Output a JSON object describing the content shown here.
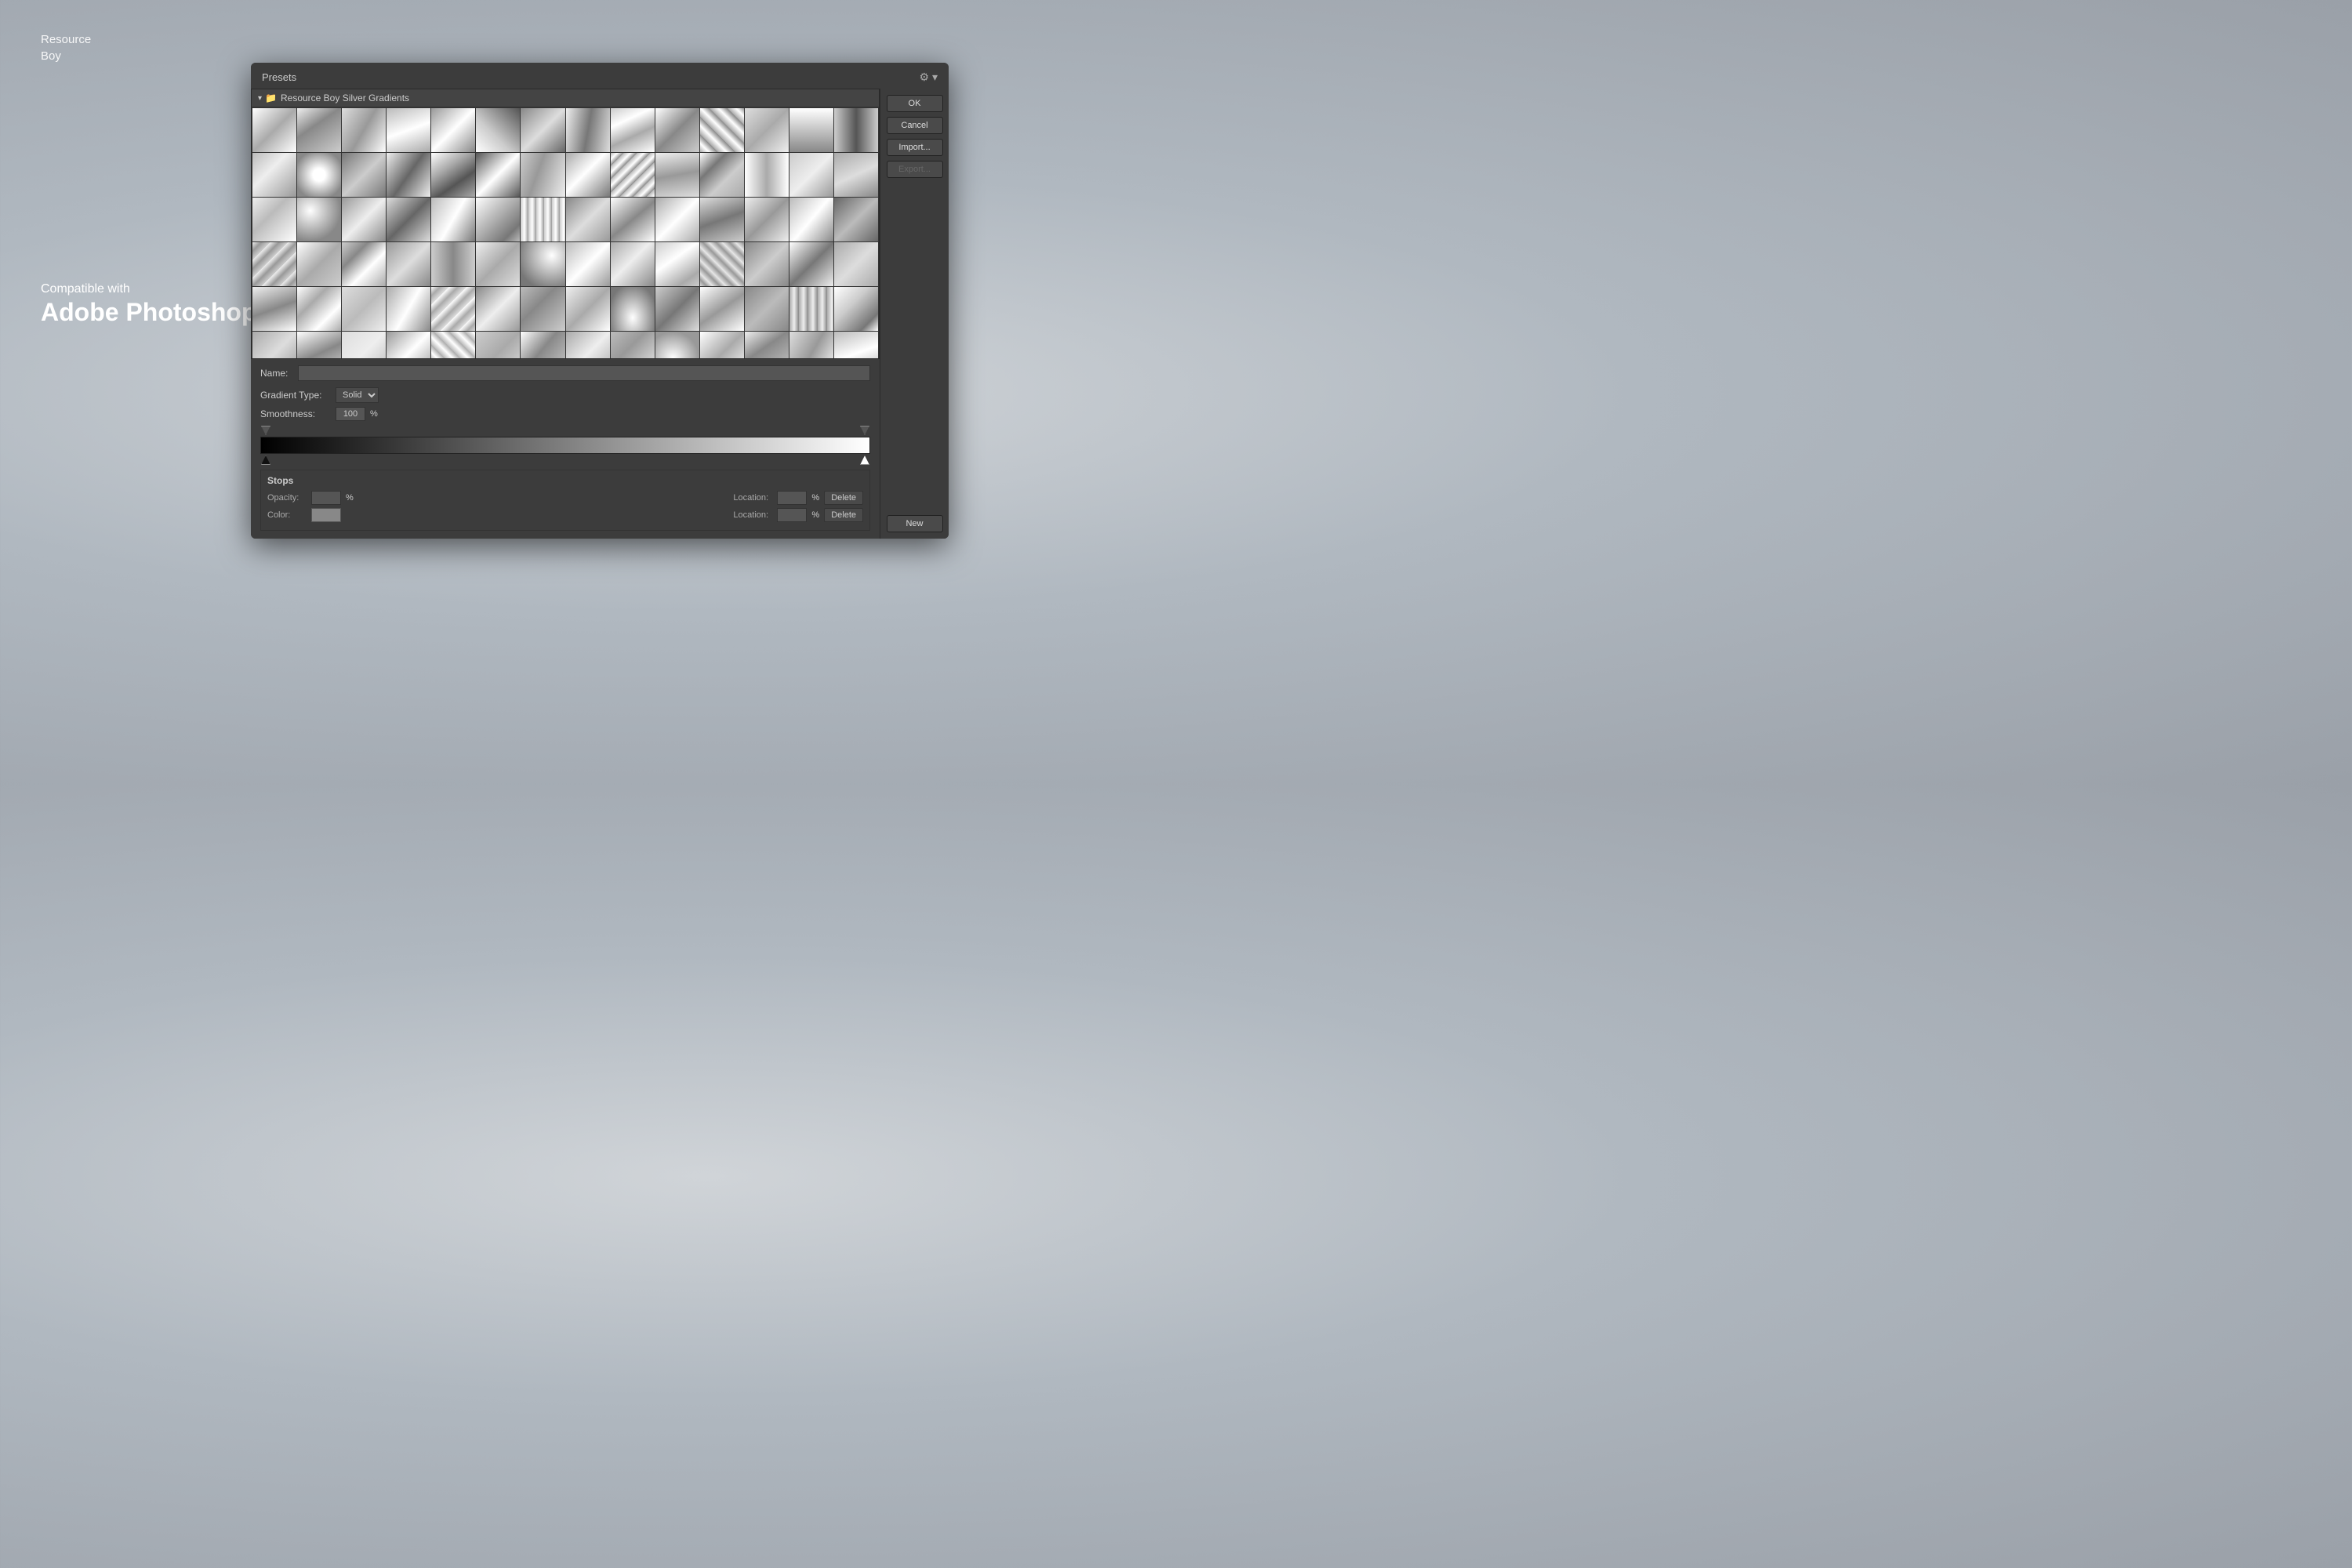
{
  "watermark": {
    "line1": "Resource",
    "line2": "Boy"
  },
  "compatible": {
    "sub": "Compatible with",
    "main": "Adobe Photoshop"
  },
  "dialog": {
    "presets_label": "Presets",
    "gear_label": "⚙ ▾",
    "folder_name": "Resource Boy Silver Gradients",
    "buttons": {
      "ok": "OK",
      "cancel": "Cancel",
      "import": "Import...",
      "export": "Export...",
      "new": "New"
    },
    "name_label": "Name:",
    "gradient_type_label": "Gradient Type:",
    "gradient_type_value": "Solid",
    "smoothness_label": "Smoothness:",
    "smoothness_value": "100",
    "smoothness_pct": "%",
    "stops": {
      "title": "Stops",
      "opacity_label": "Opacity:",
      "opacity_pct": "%",
      "location_label": "Location:",
      "location_pct": "%",
      "delete_label": "Delete",
      "color_label": "Color:",
      "color_location_label": "Location:",
      "color_location_pct": "%",
      "color_delete_label": "Delete"
    }
  }
}
